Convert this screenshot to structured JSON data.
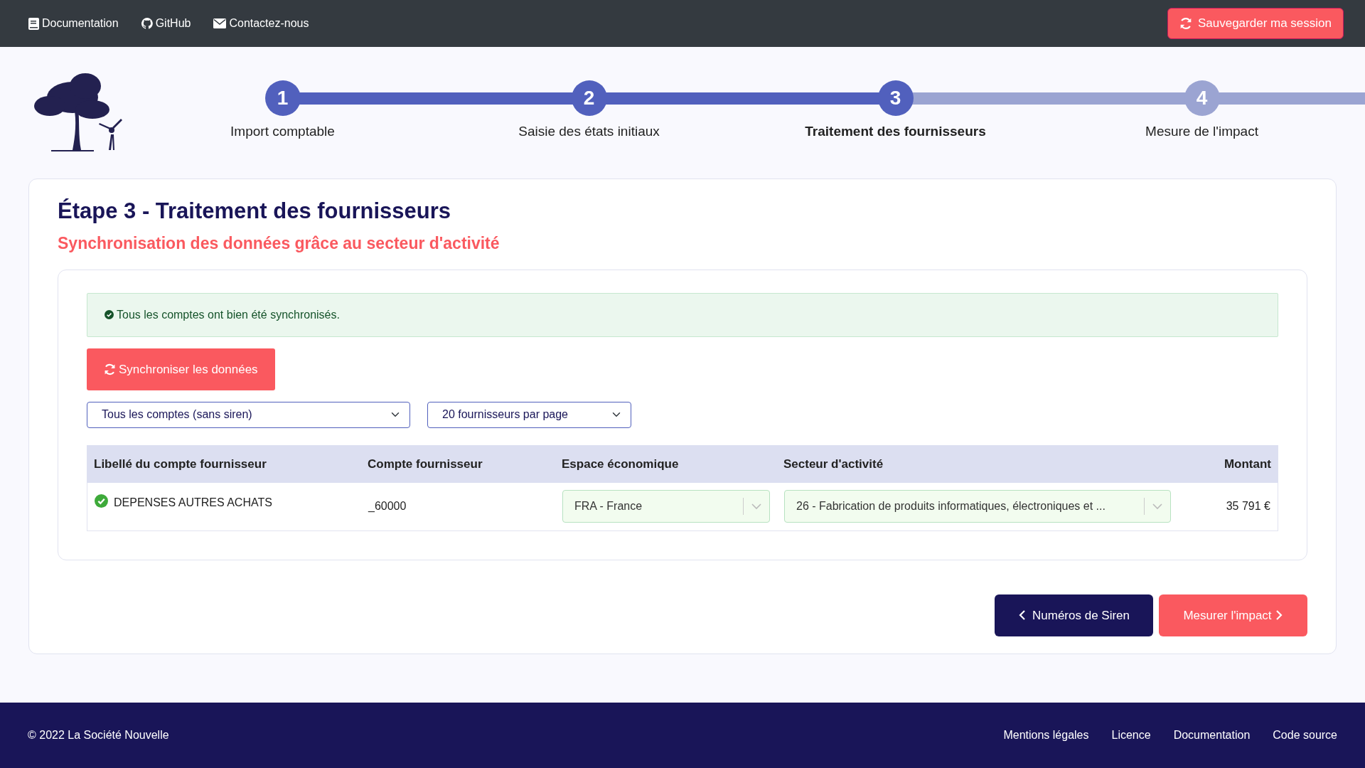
{
  "topbar": {
    "links": [
      {
        "kind": "book",
        "label": "Documentation"
      },
      {
        "kind": "github",
        "label": "GitHub"
      },
      {
        "kind": "mail",
        "label": "Contactez-nous"
      }
    ],
    "save_button": "Sauvegarder ma session"
  },
  "steps": [
    {
      "number": "1",
      "label": "Import comptable",
      "completed": true,
      "selected": false
    },
    {
      "number": "2",
      "label": "Saisie des états initiaux",
      "completed": true,
      "selected": false
    },
    {
      "number": "3",
      "label": "Traitement des fournisseurs",
      "completed": false,
      "selected": true
    },
    {
      "number": "4",
      "label": "Mesure de l'impact",
      "completed": false,
      "selected": false
    }
  ],
  "title": "Étape 3 - Traitement des fournisseurs",
  "subtitle": "Synchronisation des données grâce au secteur d'activité",
  "alert": "Tous les comptes ont bien été synchronisés.",
  "sync_button": "Synchroniser les données",
  "filters": [
    {
      "value": "Tous les comptes (sans siren)"
    },
    {
      "value": "20 fournisseurs par page"
    }
  ],
  "table": {
    "columns": [
      "Libellé du compte fournisseur",
      "Compte fournisseur",
      "Espace économique",
      "Secteur d'activité",
      "Montant"
    ],
    "rows": [
      {
        "label": "DEPENSES AUTRES ACHATS",
        "synced": true,
        "account": "_60000",
        "area": {
          "value": "FRA - France",
          "valid": true
        },
        "sector": {
          "value": "26 - Fabrication de produits informatiques, électroniques et ...",
          "valid": true
        },
        "amount": "35 791 €"
      }
    ]
  },
  "nav_buttons": {
    "back": "Numéros de Siren",
    "next": "Mesurer l'impact"
  },
  "footer": {
    "copyright": "© 2022 La Société Nouvelle",
    "links": [
      "Mentions légales",
      "Licence",
      "Documentation",
      "Code source"
    ]
  }
}
